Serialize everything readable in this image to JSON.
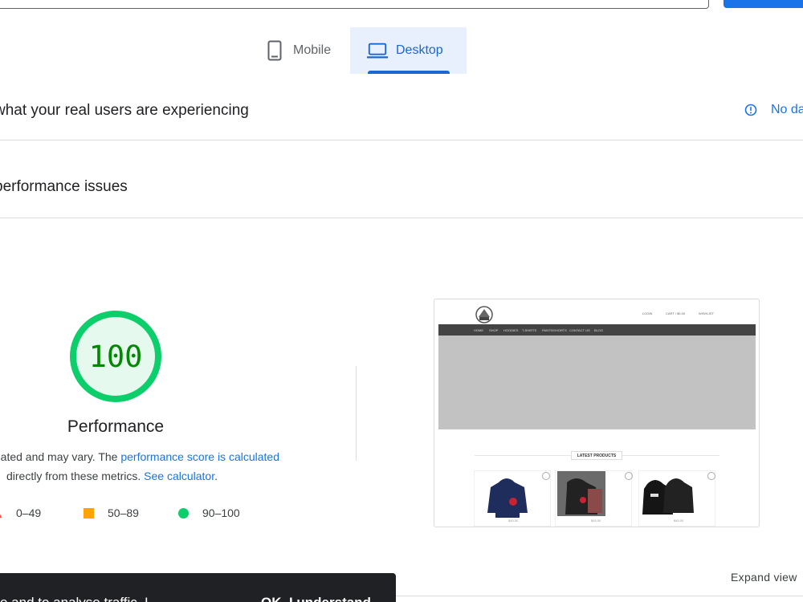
{
  "tabs": [
    {
      "label": "Mobile",
      "icon": "smartphone-icon",
      "selected": false
    },
    {
      "label": "Desktop",
      "icon": "laptop-icon",
      "selected": true
    }
  ],
  "sections": {
    "real_users": "what your real users are experiencing",
    "no_data": "No da",
    "issues": "performance issues"
  },
  "performance": {
    "score": "100",
    "score_fraction": 1.0,
    "label": "Performance",
    "note_prefix": "timated and may vary. The ",
    "note_link1": "performance score is calculated",
    "note_line2_prefix": "directly from these metrics. ",
    "note_link2": "See calculator",
    "note_line2_suffix": "."
  },
  "legend": [
    {
      "range": "0–49",
      "shape": "triangle",
      "color": "#ff4e42"
    },
    {
      "range": "50–89",
      "shape": "square",
      "color": "#ffa400"
    },
    {
      "range": "90–100",
      "shape": "circle",
      "color": "#0cce6b"
    }
  ],
  "thumbnail": {
    "header_links": [
      "LOGIN",
      "CART / $0.00",
      "WISHLIST"
    ],
    "menu": [
      "HOME",
      "SHOP",
      "HOODIES",
      "T-SHIRTS",
      "PANTS/SHORTS",
      "CONTACT US",
      "BLOG"
    ],
    "latest": "LATEST PRODUCTS",
    "prices": [
      "$45.00",
      "$45.00",
      "$45.00"
    ]
  },
  "expand": "Expand view",
  "toast": {
    "text": "e and to analyse traffic. L",
    "button": "OK, I understand"
  },
  "colors": {
    "accent": "#1a73e8",
    "pass": "#0cce6b",
    "average": "#ffa400",
    "fail": "#ff4e42"
  }
}
